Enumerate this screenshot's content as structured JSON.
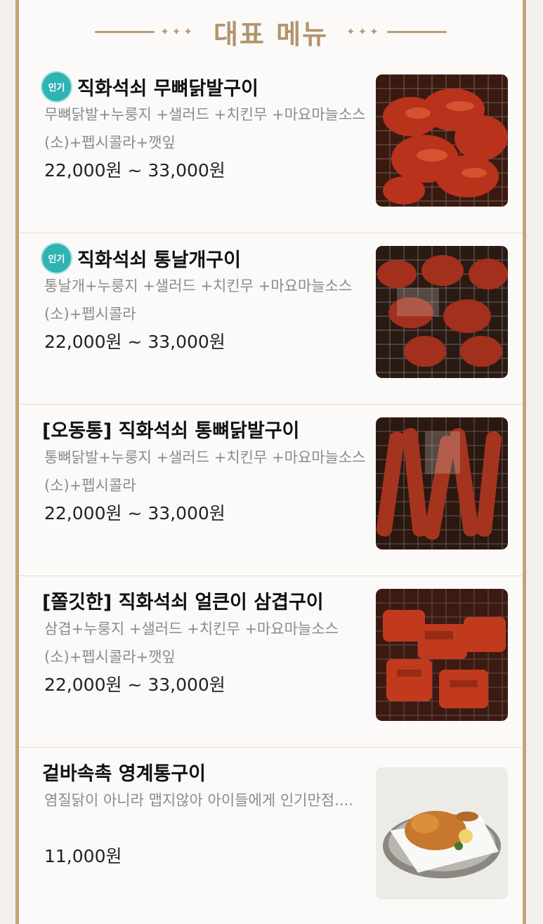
{
  "header": {
    "title": "대표 메뉴",
    "left_ornament": "✦✦✦",
    "right_ornament": "✦✦✦"
  },
  "items": [
    {
      "badge": "인기",
      "name": "직화석쇠 무뼈닭발구이",
      "desc": "무뼈닭발+누룽지 +샐러드 +치킨무 +마요마늘소스(소)+펩시콜라+깻잎",
      "price": "22,000원 ~ 33,000원",
      "photo": "spicy-boneless-chicken-feet-photo"
    },
    {
      "badge": "인기",
      "name": "직화석쇠 통날개구이",
      "desc": "통날개+누룽지 +샐러드 +치킨무 +마요마늘소스(소)+펩시콜라",
      "price": "22,000원 ~ 33,000원",
      "photo": "grilled-chicken-wings-photo"
    },
    {
      "name": "[오동통] 직화석쇠 통뼈닭발구이",
      "desc": "통뼈닭발+누룽지 +샐러드 +치킨무 +마요마늘소스(소)+펩시콜라",
      "price": "22,000원 ~ 33,000원",
      "photo": "grilled-chicken-feet-photo"
    },
    {
      "name": "[쫄깃한] 직화석쇠 얼큰이  삼겹구이",
      "desc": "삼겹+누룽지 +샐러드 +치킨무 +마요마늘소스(소)+펩시콜라+깻잎",
      "price": "22,000원 ~ 33,000원",
      "photo": "spicy-pork-belly-photo"
    },
    {
      "name": "겉바속촉 영계통구이",
      "desc": "염질닭이 아니라 맵지않아 아이들에게 인기만점....",
      "price": "11,000원",
      "photo": "roast-whole-chicken-photo"
    }
  ]
}
